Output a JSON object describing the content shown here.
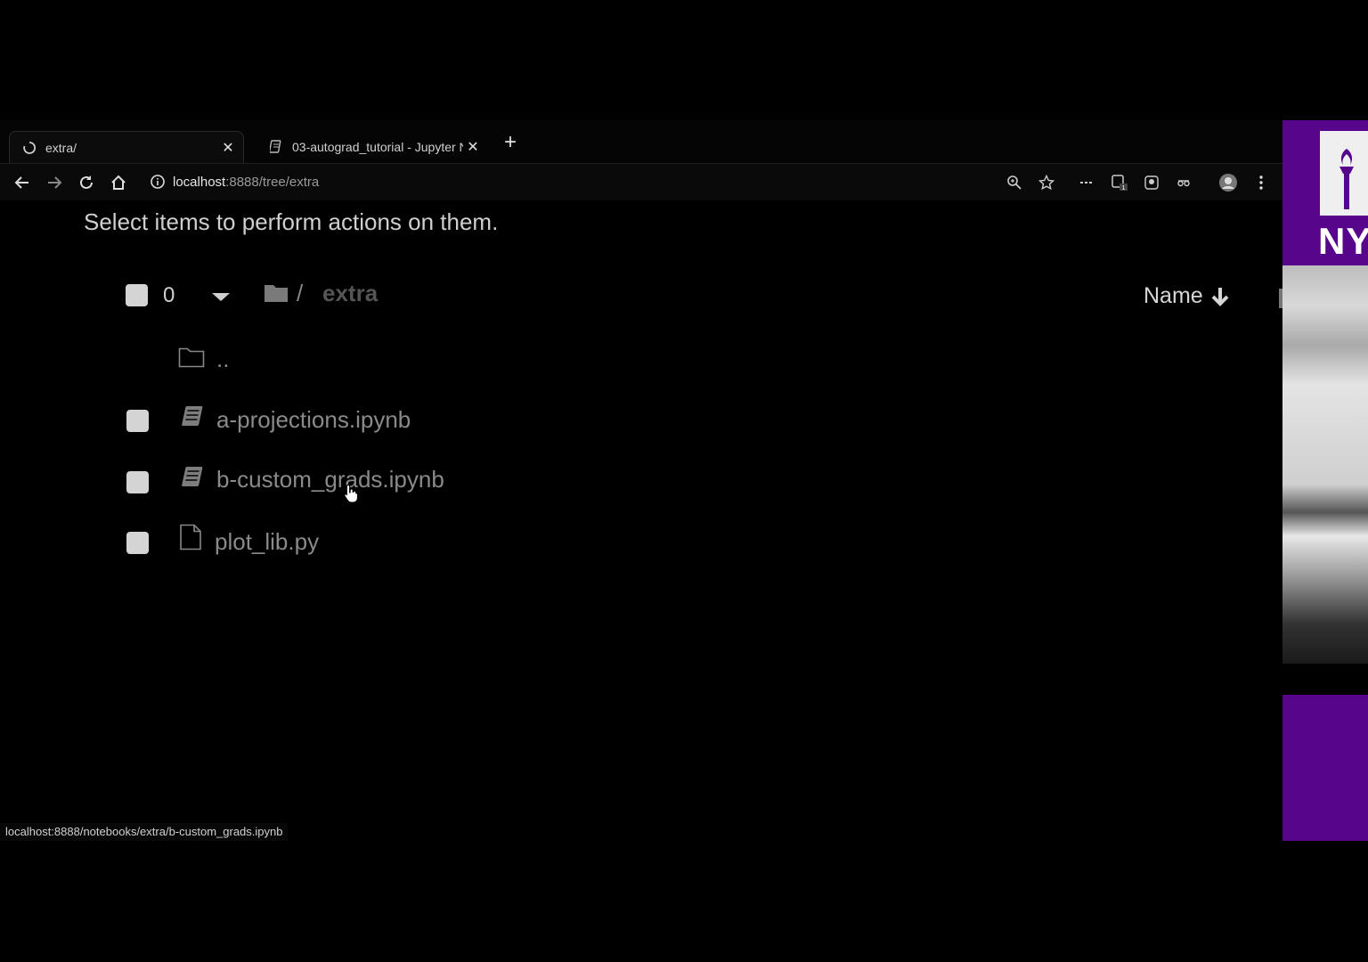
{
  "browser": {
    "tabs": [
      {
        "title": "extra/",
        "active": true
      },
      {
        "title": "03-autograd_tutorial - Jupyter N",
        "active": false
      }
    ],
    "new_tab_label": "+",
    "close_glyph": "✕",
    "url_host": "localhost",
    "url_rest": ":8888/tree/extra",
    "status_url": "localhost:8888/notebooks/extra/b-custom_grads.ipynb"
  },
  "file_browser": {
    "instructions": "Select items to perform actions on them.",
    "selected_count": "0",
    "breadcrumb_separator": "/",
    "breadcrumb_current": "extra",
    "sort_label": "Name",
    "sort_icon": "arrow-down-icon",
    "parent_dir_label": "..",
    "files": [
      {
        "name": "a-projections.ipynb",
        "icon": "notebook-icon"
      },
      {
        "name": "b-custom_grads.ipynb",
        "icon": "notebook-icon"
      },
      {
        "name": "plot_lib.py",
        "icon": "file-icon"
      }
    ]
  },
  "side_panel": {
    "logo_text": "NY",
    "brand_color": "#57068c"
  },
  "colors": {
    "background": "#000000",
    "text": "#cfcfcf",
    "file_text": "#8a8a8a"
  }
}
